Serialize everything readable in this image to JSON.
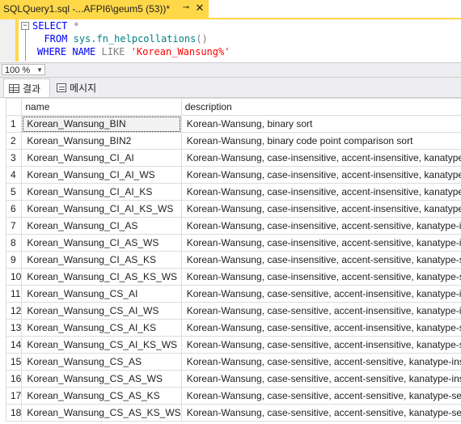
{
  "tab": {
    "title": "SQLQuery1.sql -...AFPI6\\geum5 (53))*",
    "pin_icon": "pin-icon",
    "close_icon": "close-icon"
  },
  "editor": {
    "collapse_glyph": "⊟",
    "line1": {
      "kw": "SELECT",
      "rest": " *"
    },
    "line2": {
      "kw": "FROM",
      "fn": "sys.fn_helpcollations",
      "paren": "()"
    },
    "line3": {
      "kw1": "WHERE",
      "kw2": "NAME",
      "kw3": "LIKE",
      "str": "'Korean_Wansung%'"
    }
  },
  "zoom": {
    "value": "100 %"
  },
  "results_tabs": [
    {
      "label": "결과",
      "icon": "grid-icon"
    },
    {
      "label": "메시지",
      "icon": "messages-icon"
    }
  ],
  "grid": {
    "columns": [
      "name",
      "description"
    ],
    "rows": [
      [
        "1",
        "Korean_Wansung_BIN",
        "Korean-Wansung, binary sort"
      ],
      [
        "2",
        "Korean_Wansung_BIN2",
        "Korean-Wansung, binary code point comparison sort"
      ],
      [
        "3",
        "Korean_Wansung_CI_AI",
        "Korean-Wansung, case-insensitive, accent-insensitive, kanatype-insensitive, width-insensitive"
      ],
      [
        "4",
        "Korean_Wansung_CI_AI_WS",
        "Korean-Wansung, case-insensitive, accent-insensitive, kanatype-insensitive, width-sensitive"
      ],
      [
        "5",
        "Korean_Wansung_CI_AI_KS",
        "Korean-Wansung, case-insensitive, accent-insensitive, kanatype-sensitive, width-insensitive"
      ],
      [
        "6",
        "Korean_Wansung_CI_AI_KS_WS",
        "Korean-Wansung, case-insensitive, accent-insensitive, kanatype-sensitive, width-sensitive"
      ],
      [
        "7",
        "Korean_Wansung_CI_AS",
        "Korean-Wansung, case-insensitive, accent-sensitive, kanatype-insensitive, width-insensitive"
      ],
      [
        "8",
        "Korean_Wansung_CI_AS_WS",
        "Korean-Wansung, case-insensitive, accent-sensitive, kanatype-insensitive, width-sensitive"
      ],
      [
        "9",
        "Korean_Wansung_CI_AS_KS",
        "Korean-Wansung, case-insensitive, accent-sensitive, kanatype-sensitive, width-insensitive"
      ],
      [
        "10",
        "Korean_Wansung_CI_AS_KS_WS",
        "Korean-Wansung, case-insensitive, accent-sensitive, kanatype-sensitive, width-sensitive"
      ],
      [
        "11",
        "Korean_Wansung_CS_AI",
        "Korean-Wansung, case-sensitive, accent-insensitive, kanatype-insensitive, width-insensitive"
      ],
      [
        "12",
        "Korean_Wansung_CS_AI_WS",
        "Korean-Wansung, case-sensitive, accent-insensitive, kanatype-insensitive, width-sensitive"
      ],
      [
        "13",
        "Korean_Wansung_CS_AI_KS",
        "Korean-Wansung, case-sensitive, accent-insensitive, kanatype-sensitive, width-insensitive"
      ],
      [
        "14",
        "Korean_Wansung_CS_AI_KS_WS",
        "Korean-Wansung, case-sensitive, accent-insensitive, kanatype-sensitive, width-sensitive"
      ],
      [
        "15",
        "Korean_Wansung_CS_AS",
        "Korean-Wansung, case-sensitive, accent-sensitive, kanatype-insensitive, width-insensitive"
      ],
      [
        "16",
        "Korean_Wansung_CS_AS_WS",
        "Korean-Wansung, case-sensitive, accent-sensitive, kanatype-insensitive, width-sensitive"
      ],
      [
        "17",
        "Korean_Wansung_CS_AS_KS",
        "Korean-Wansung, case-sensitive, accent-sensitive, kanatype-sensitive, width-insensitive"
      ],
      [
        "18",
        "Korean_Wansung_CS_AS_KS_WS",
        "Korean-Wansung, case-sensitive, accent-sensitive, kanatype-sensitive, width-sensitive"
      ]
    ]
  },
  "colors": {
    "accent": "#ffd84a",
    "keyword": "#0000ff",
    "function": "#008080",
    "string": "#ff0000"
  }
}
